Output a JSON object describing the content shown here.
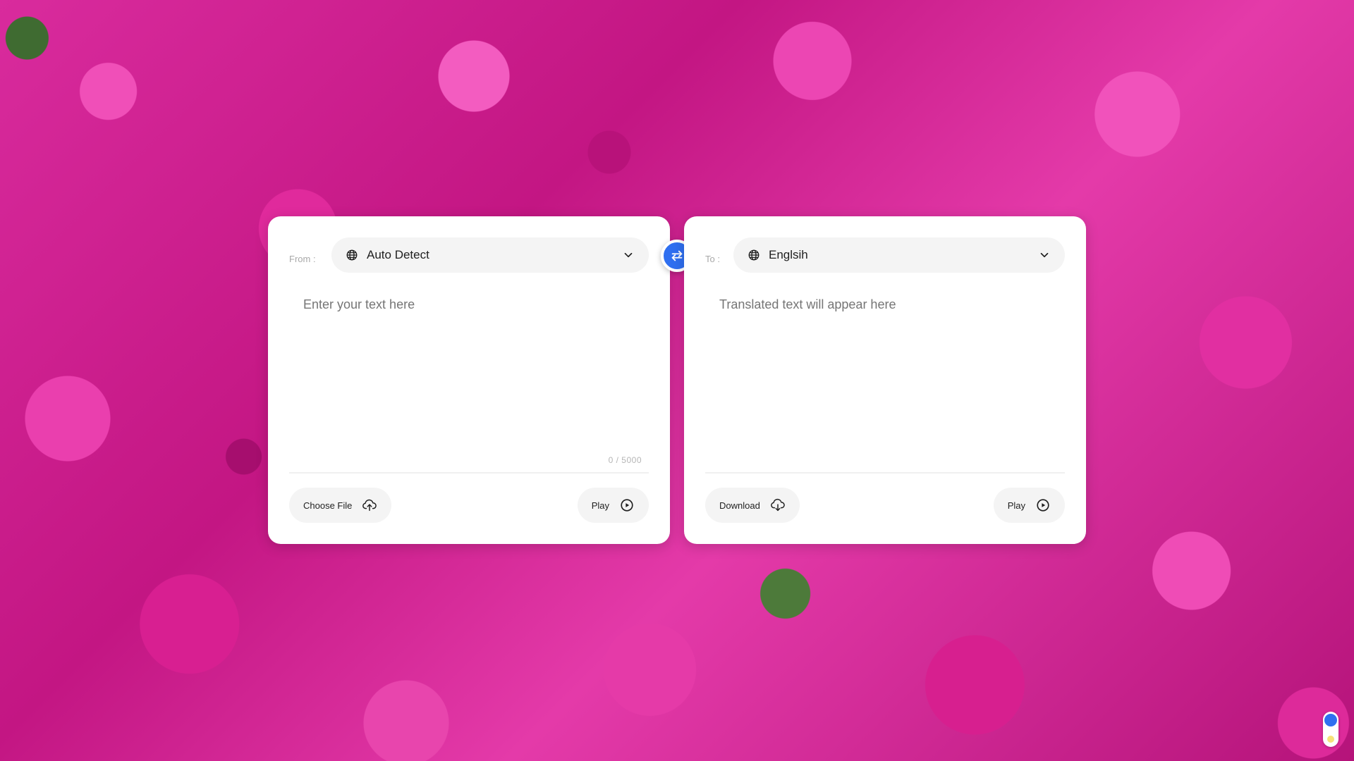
{
  "source": {
    "label": "From :",
    "language": "Auto Detect",
    "placeholder": "Enter your text here",
    "char_count": "0 / 5000",
    "choose_file_label": "Choose File",
    "play_label": "Play"
  },
  "target": {
    "label": "To :",
    "language": "Englsih",
    "placeholder": "Translated text will appear here",
    "download_label": "Download",
    "play_label": "Play"
  },
  "icons": {
    "language": "globe-icon",
    "dropdown": "chevron-down-icon",
    "swap": "swap-arrows-icon",
    "upload": "cloud-upload-icon",
    "download": "cloud-download-icon",
    "play": "play-circle-icon"
  },
  "colors": {
    "accent": "#2f6ff0",
    "panel_bg": "#ffffff",
    "pill_bg": "#f4f4f4",
    "placeholder_text": "#757575",
    "toggle_dot": "#f6e27a"
  }
}
